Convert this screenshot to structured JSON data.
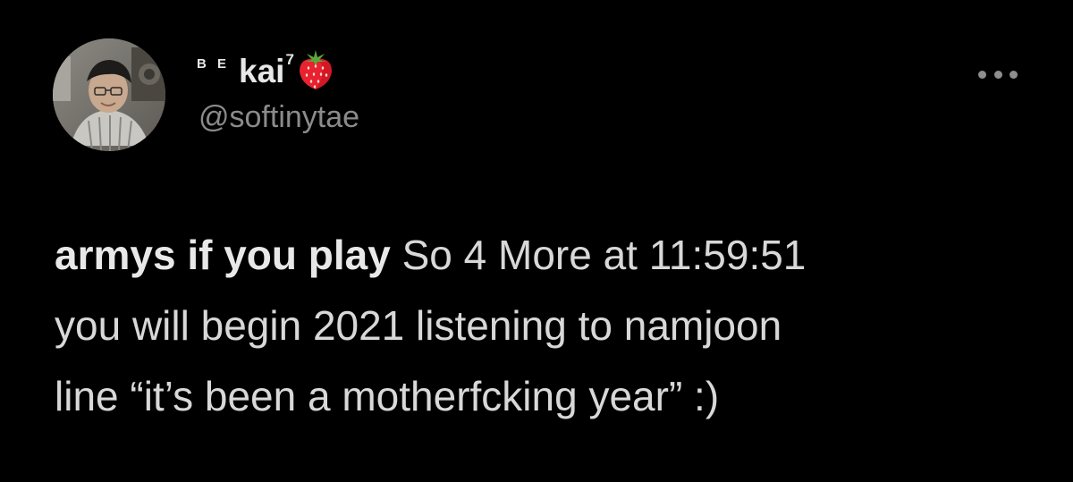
{
  "tweet": {
    "author": {
      "name_prefix": "B E",
      "name": "kai",
      "name_superscript": "7",
      "name_emoji": "strawberry-icon",
      "handle": "@softinytae",
      "avatar": "profile-photo"
    },
    "menu_icon": "more-options-icon",
    "body": {
      "line1_bold": "armys if you play",
      "line1_rest": " So 4 More at 11:59:51",
      "line2": "you will begin 2021 listening to namjoon",
      "line3": "line “it’s been a motherfcking year” :)"
    }
  },
  "colors": {
    "background": "#000000",
    "text_primary": "#d8d8d8",
    "text_secondary": "#8b8b8b",
    "strawberry": "#e8222f"
  }
}
